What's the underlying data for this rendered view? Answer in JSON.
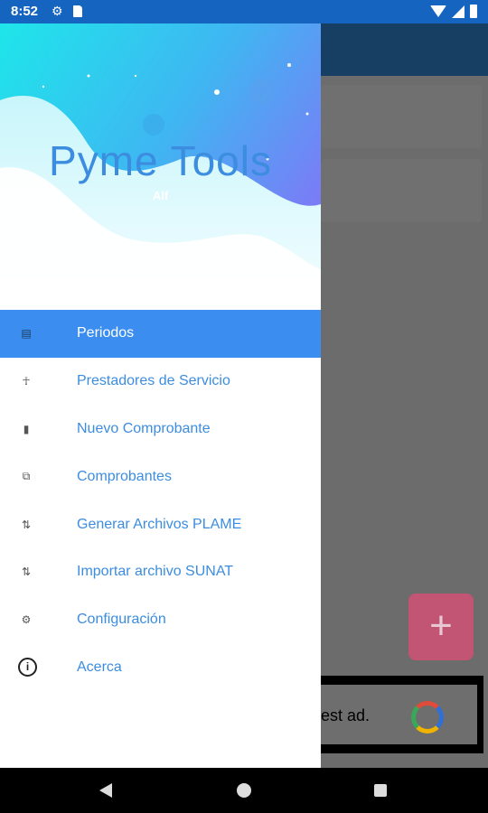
{
  "status_bar": {
    "time": "8:52",
    "icons": [
      "gear-icon",
      "sd-card-icon",
      "wifi-icon",
      "signal-icon",
      "battery-icon"
    ]
  },
  "drawer": {
    "title": "Pyme Tools",
    "user": "Alf",
    "items": [
      {
        "label": "Periodos",
        "icon": "calendar-icon",
        "active": true
      },
      {
        "label": "Prestadores de Servicio",
        "icon": "person-icon"
      },
      {
        "label": "Nuevo Comprobante",
        "icon": "document-icon"
      },
      {
        "label": "Comprobantes",
        "icon": "documents-icon"
      },
      {
        "label": "Generar Archivos PLAME",
        "icon": "swap-vertical-icon"
      },
      {
        "label": "Importar archivo SUNAT",
        "icon": "swap-vertical-icon"
      },
      {
        "label": "Configuración",
        "icon": "gear-icon"
      },
      {
        "label": "Acerca",
        "icon": "info-icon"
      }
    ]
  },
  "background": {
    "fab_label": "+",
    "ad_text": "est ad."
  },
  "colors": {
    "accent": "#3b8ef0",
    "status_bar": "#1565c0",
    "toolbar": "#173e63",
    "fab": "#c25474"
  }
}
